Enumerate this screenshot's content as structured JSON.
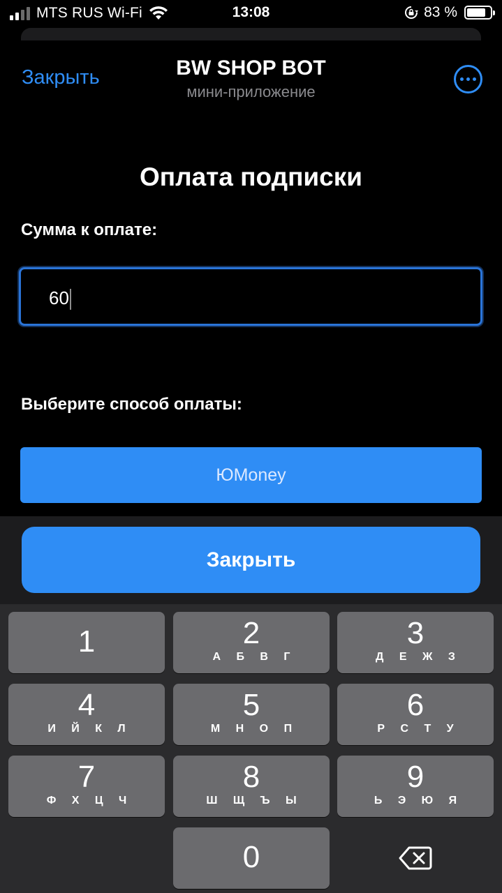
{
  "status_bar": {
    "carrier": "MTS RUS Wi-Fi",
    "time": "13:08",
    "battery": "83 %"
  },
  "header": {
    "close_label": "Закрыть",
    "title": "BW SHOP BOT",
    "subtitle": "мини-приложение"
  },
  "main": {
    "page_title": "Оплата подписки",
    "amount_label": "Сумма к оплате:",
    "amount_value": "60",
    "method_label": "Выберите способ оплаты:",
    "method_button": "ЮMoney"
  },
  "bottom": {
    "close_button": "Закрыть"
  },
  "keypad": [
    {
      "digit": "1",
      "letters": ""
    },
    {
      "digit": "2",
      "letters": "А Б В Г"
    },
    {
      "digit": "3",
      "letters": "Д Е Ж З"
    },
    {
      "digit": "4",
      "letters": "И Й К Л"
    },
    {
      "digit": "5",
      "letters": "М Н О П"
    },
    {
      "digit": "6",
      "letters": "Р С Т У"
    },
    {
      "digit": "7",
      "letters": "Ф Х Ц Ч"
    },
    {
      "digit": "8",
      "letters": "Ш Щ Ъ Ы"
    },
    {
      "digit": "9",
      "letters": "Ь Э Ю Я"
    },
    {
      "digit": "0",
      "letters": ""
    }
  ],
  "colors": {
    "accent": "#2f8df5",
    "key": "#6b6b6e",
    "keypad_bg": "#2b2b2d"
  }
}
